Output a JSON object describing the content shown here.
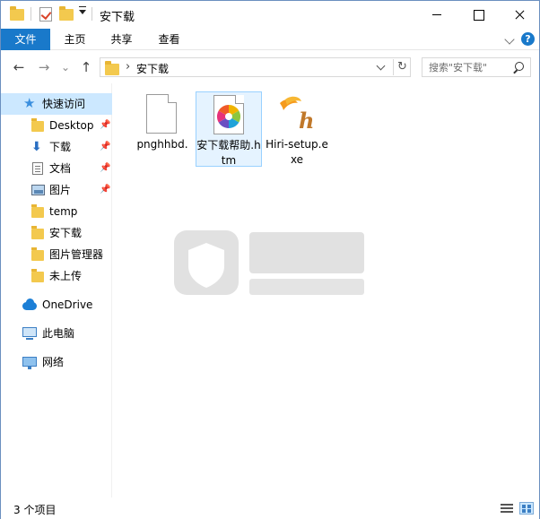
{
  "window": {
    "title": "安下载"
  },
  "ribbon": {
    "tabs": [
      {
        "label": "文件",
        "active": true
      },
      {
        "label": "主页",
        "active": false
      },
      {
        "label": "共享",
        "active": false
      },
      {
        "label": "查看",
        "active": false
      }
    ],
    "accent_color": "#1979ca"
  },
  "address_bar": {
    "separator": "›",
    "current_path": "安下载",
    "refresh_glyph": "↻"
  },
  "search": {
    "placeholder": "搜索\"安下载\""
  },
  "nav_glyphs": {
    "back": "←",
    "forward": "→",
    "recent": "⌄",
    "up": "↑"
  },
  "sidebar": {
    "pin_glyph": "📌",
    "items": [
      {
        "label": "快速访问",
        "icon": "star-icon",
        "selected": true,
        "pinned": false
      },
      {
        "label": "Desktop",
        "icon": "folder-icon",
        "selected": false,
        "pinned": true
      },
      {
        "label": "下载",
        "icon": "download-icon",
        "selected": false,
        "pinned": true
      },
      {
        "label": "文档",
        "icon": "document-icon",
        "selected": false,
        "pinned": true
      },
      {
        "label": "图片",
        "icon": "picture-icon",
        "selected": false,
        "pinned": true
      },
      {
        "label": "temp",
        "icon": "folder-icon",
        "selected": false,
        "pinned": false
      },
      {
        "label": "安下载",
        "icon": "folder-icon",
        "selected": false,
        "pinned": false
      },
      {
        "label": "图片管理器",
        "icon": "folder-icon",
        "selected": false,
        "pinned": false
      },
      {
        "label": "未上传",
        "icon": "folder-icon",
        "selected": false,
        "pinned": false
      },
      {
        "label": "OneDrive",
        "icon": "cloud-icon",
        "selected": false,
        "pinned": false
      },
      {
        "label": "此电脑",
        "icon": "computer-icon",
        "selected": false,
        "pinned": false
      },
      {
        "label": "网络",
        "icon": "network-icon",
        "selected": false,
        "pinned": false
      }
    ]
  },
  "files": [
    {
      "name": "pnghhbd.",
      "icon": "generic-file-icon",
      "selected": false
    },
    {
      "name": "安下载帮助.htm",
      "icon": "htm-file-icon",
      "selected": true
    },
    {
      "name": "Hiri-setup.exe",
      "icon": "hiri-app-icon",
      "selected": false
    }
  ],
  "status": {
    "item_count": "3 个项目"
  }
}
